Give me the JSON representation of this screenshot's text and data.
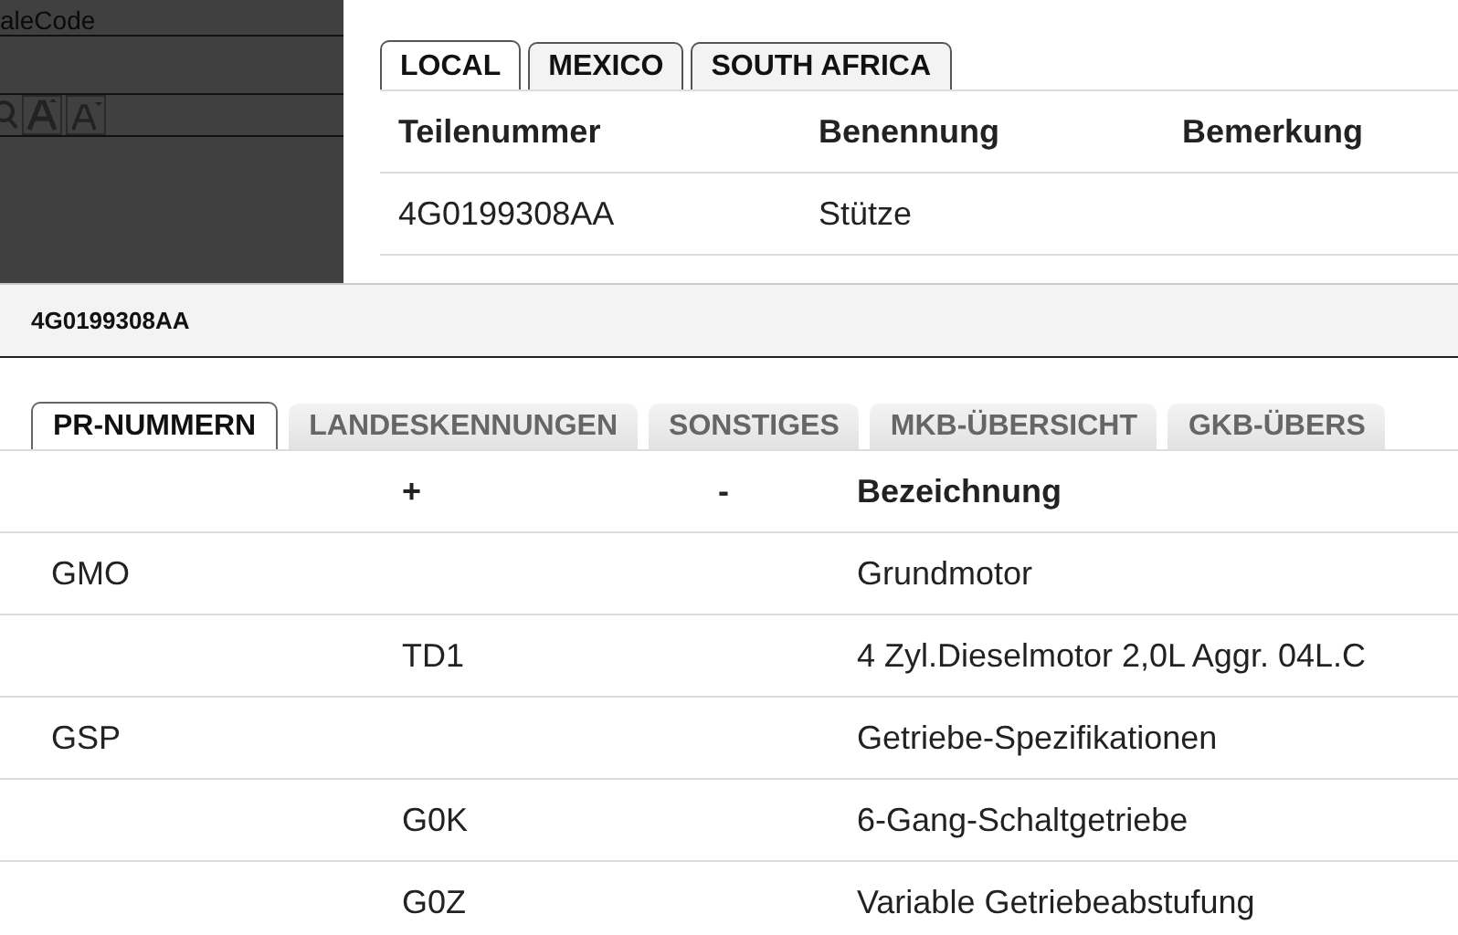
{
  "side_panel": {
    "label": "aleCode"
  },
  "region_tabs": [
    {
      "label": "LOCAL",
      "selected": true
    },
    {
      "label": "MEXICO",
      "selected": false
    },
    {
      "label": "SOUTH AFRICA",
      "selected": false
    }
  ],
  "parts_table": {
    "columns": [
      "Teilenummer",
      "Benennung",
      "Bemerkung"
    ],
    "rows": [
      [
        "4G0199308AA",
        "Stütze",
        ""
      ]
    ]
  },
  "detail_bar": {
    "title": "4G0199308AA"
  },
  "detail_tabs": [
    {
      "label": "PR-NUMMERN",
      "selected": true
    },
    {
      "label": "LANDESKENNUNGEN",
      "selected": false
    },
    {
      "label": "SONSTIGES",
      "selected": false
    },
    {
      "label": "MKB-ÜBERSICHT",
      "selected": false
    },
    {
      "label": "GKB-ÜBERS",
      "selected": false
    }
  ],
  "pr_table": {
    "columns": [
      "",
      "+",
      "-",
      "Bezeichnung"
    ],
    "rows": [
      [
        "GMO",
        "",
        "",
        "Grundmotor"
      ],
      [
        "",
        "TD1",
        "",
        "4 Zyl.Dieselmotor 2,0L Aggr. 04L.C"
      ],
      [
        "GSP",
        "",
        "",
        "Getriebe-Spezifikationen"
      ],
      [
        "",
        "G0K",
        "",
        "6-Gang-Schaltgetriebe"
      ],
      [
        "",
        "G0Z",
        "",
        "Variable Getriebeabstufung"
      ]
    ]
  }
}
